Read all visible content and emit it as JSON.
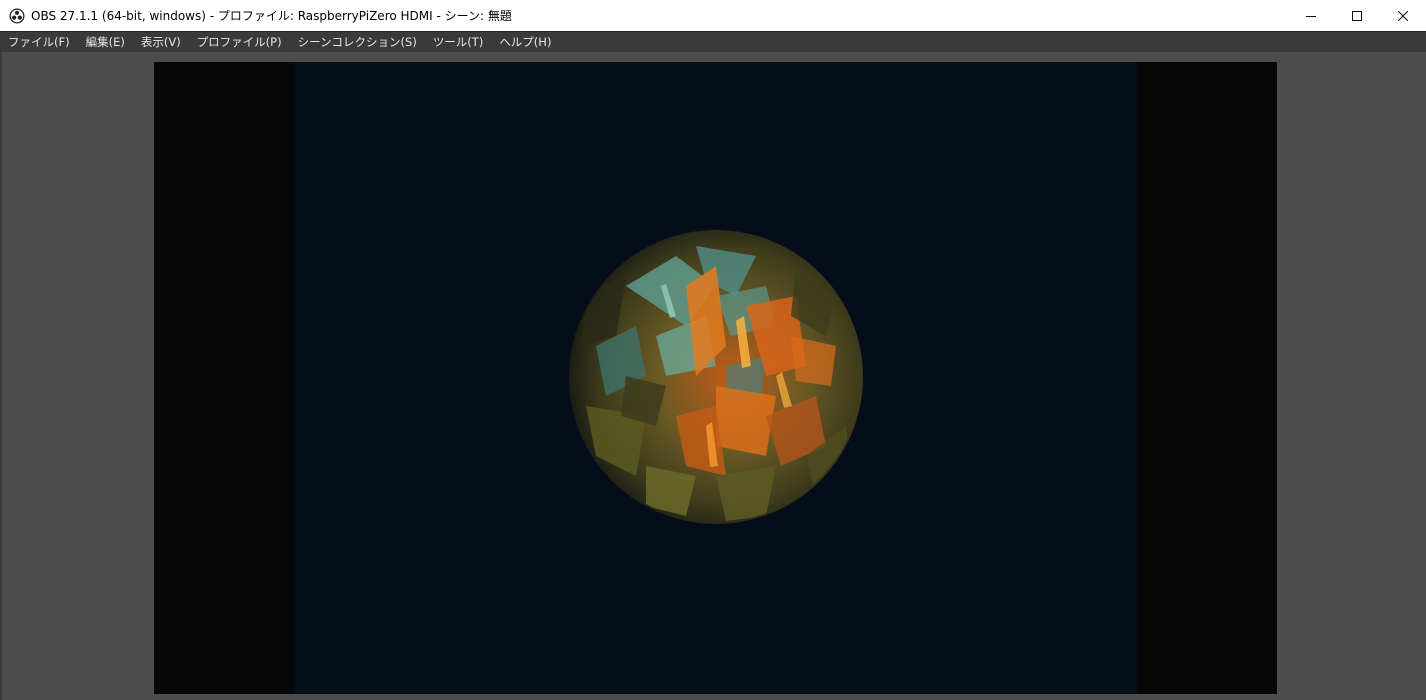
{
  "window": {
    "title": "OBS 27.1.1 (64-bit, windows) - プロファイル: RaspberryPiZero HDMI - シーン: 無題",
    "app_icon": "obs-icon",
    "controls": [
      "minimize-icon",
      "maximize-icon",
      "close-icon"
    ]
  },
  "menu": {
    "items": [
      {
        "label": "ファイル(F)"
      },
      {
        "label": "編集(E)"
      },
      {
        "label": "表示(V)"
      },
      {
        "label": "プロファイル(P)"
      },
      {
        "label": "シーンコレクション(S)"
      },
      {
        "label": "ツール(T)"
      },
      {
        "label": "ヘルプ(H)"
      }
    ]
  },
  "colors": {
    "titlebar_bg": "#ffffff",
    "menubar_bg": "#3a3a3a",
    "workspace_bg": "#4c4c4c",
    "letterbox": "#070707",
    "video_bg": "#050d1b",
    "sphere_teal": "#5e9a8c",
    "sphere_orange": "#e0701a",
    "sphere_olive": "#6b6a2a"
  }
}
